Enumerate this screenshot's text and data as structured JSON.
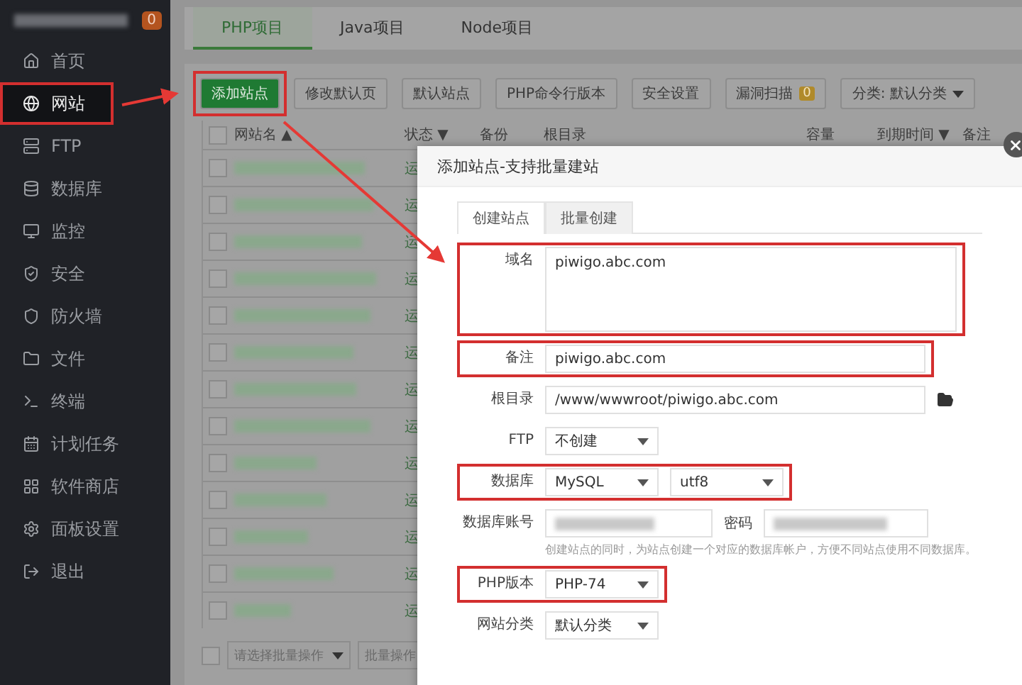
{
  "sidebar": {
    "badge": "0",
    "items": [
      {
        "label": "首页",
        "selected": false,
        "highlighted": false
      },
      {
        "label": "网站",
        "selected": true,
        "highlighted": true
      },
      {
        "label": "FTP",
        "selected": false,
        "highlighted": false
      },
      {
        "label": "数据库",
        "selected": false,
        "highlighted": false
      },
      {
        "label": "监控",
        "selected": false,
        "highlighted": false
      },
      {
        "label": "安全",
        "selected": false,
        "highlighted": false
      },
      {
        "label": "防火墙",
        "selected": false,
        "highlighted": false
      },
      {
        "label": "文件",
        "selected": false,
        "highlighted": false
      },
      {
        "label": "终端",
        "selected": false,
        "highlighted": false
      },
      {
        "label": "计划任务",
        "selected": false,
        "highlighted": false
      },
      {
        "label": "软件商店",
        "selected": false,
        "highlighted": false
      },
      {
        "label": "面板设置",
        "selected": false,
        "highlighted": false
      },
      {
        "label": "退出",
        "selected": false,
        "highlighted": false
      }
    ]
  },
  "tabs": [
    {
      "label": "PHP项目",
      "selected": true
    },
    {
      "label": "Java项目",
      "selected": false
    },
    {
      "label": "Node项目",
      "selected": false
    }
  ],
  "toolbar": [
    {
      "kind": "primary",
      "label": "添加站点",
      "highlighted": true
    },
    {
      "kind": "default",
      "label": "修改默认页",
      "highlighted": false
    },
    {
      "kind": "default",
      "label": "默认站点",
      "highlighted": false
    },
    {
      "kind": "default",
      "label": "PHP命令行版本",
      "highlighted": false
    },
    {
      "kind": "default",
      "label": "安全设置",
      "highlighted": false
    },
    {
      "kind": "badge",
      "label": "漏洞扫描",
      "badge": "0",
      "highlighted": false
    },
    {
      "kind": "dropdown",
      "label": "分类: 默认分类",
      "highlighted": false
    }
  ],
  "table": {
    "columns": [
      {
        "label": "网站名",
        "arrow": "▲"
      },
      {
        "label": "状态",
        "arrow": "▼"
      },
      {
        "label": "备份"
      },
      {
        "label": "根目录"
      },
      {
        "label": "容量"
      },
      {
        "label": "到期时间",
        "arrow": "▼"
      },
      {
        "label": "备注"
      }
    ],
    "header_checked": false,
    "rows": [
      {
        "checked": false,
        "status": "运"
      },
      {
        "checked": false,
        "status": "运"
      },
      {
        "checked": false,
        "status": "运"
      },
      {
        "checked": false,
        "status": "运"
      },
      {
        "checked": false,
        "status": "运"
      },
      {
        "checked": false,
        "status": "运"
      },
      {
        "checked": false,
        "status": "运"
      },
      {
        "checked": false,
        "status": "运"
      },
      {
        "checked": false,
        "status": "运"
      },
      {
        "checked": false,
        "status": "运"
      },
      {
        "checked": false,
        "status": "运"
      },
      {
        "checked": false,
        "status": "运"
      },
      {
        "checked": false,
        "status": "运"
      }
    ]
  },
  "footer": {
    "checked": false,
    "batch_select": "请选择批量操作",
    "batch_button": "批量操作"
  },
  "dialog": {
    "title": "添加站点-支持批量建站",
    "tabs": [
      {
        "label": "创建站点",
        "selected": true
      },
      {
        "label": "批量创建",
        "selected": false
      }
    ],
    "fields": [
      {
        "kind": "textarea",
        "label": "域名",
        "value": "piwigo.abc.com",
        "highlighted": true
      },
      {
        "kind": "input",
        "label": "备注",
        "value": "piwigo.abc.com",
        "highlighted": true
      },
      {
        "kind": "path",
        "label": "根目录",
        "value": "/www/wwwroot/piwigo.abc.com",
        "highlighted": false
      },
      {
        "kind": "select",
        "label": "FTP",
        "values": [
          "不创建"
        ],
        "highlighted": false
      },
      {
        "kind": "select",
        "label": "数据库",
        "values": [
          "MySQL",
          "utf8"
        ],
        "highlighted": true
      },
      {
        "kind": "account",
        "label": "数据库账号",
        "label_2": "密码",
        "hint": "创建站点的同时，为站点创建一个对应的数据库帐户，方便不同站点使用不同数据库。",
        "highlighted": false
      },
      {
        "kind": "select",
        "label": "PHP版本",
        "values": [
          "PHP-74"
        ],
        "highlighted": true
      },
      {
        "kind": "select",
        "label": "网站分类",
        "values": [
          "默认分类"
        ],
        "highlighted": false
      }
    ]
  }
}
